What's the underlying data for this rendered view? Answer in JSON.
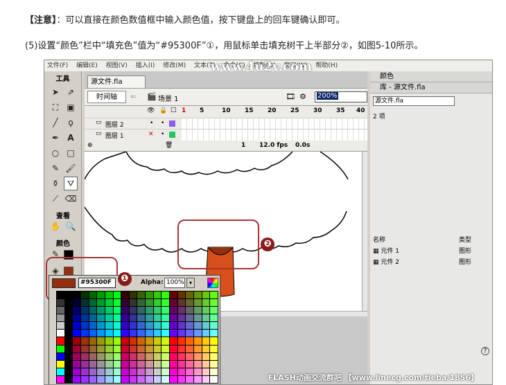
{
  "notes": {
    "line1_bracket": "【注意】",
    "line1_text": "：可以直接在颜色数值框中输入颜色值，按下键盘上的回车键确认即可。",
    "line2_text": "(5)设置“颜色”栏中“填充色”值为“#95300F”①，用鼠标单击填充树干上半部分②，如图5-10所示。"
  },
  "menubar": {
    "items": [
      "文件(F)",
      "编辑(E)",
      "视图(V)",
      "插入(I)",
      "修改(M)",
      "文本(T)",
      "命令(C)",
      "控制(O)",
      "窗口(W)",
      "帮助(H)"
    ]
  },
  "watermark": "www.4u2v.com",
  "tools": {
    "header": "工具",
    "view_header": "查看",
    "colors_header": "颜色"
  },
  "document": {
    "tab": "源文件.fla",
    "timeline_label": "时间轴",
    "scene_label": "场景 1",
    "zoom": "200%",
    "frame_numbers": [
      "1",
      "5",
      "10",
      "15",
      "20",
      "25",
      "30",
      "35",
      "40"
    ],
    "layers": [
      {
        "name": "图层 2",
        "color": "#8b5cf6"
      },
      {
        "name": "图层 1",
        "color": "#22c55e"
      }
    ],
    "status": {
      "frame": "1",
      "fps": "12.0 fps",
      "time": "0.0s"
    }
  },
  "right_panel": {
    "colors_title": "颜色",
    "library_title": "库 - 源文件.fla",
    "library_select": "源文件.fla",
    "item_count": "2 项",
    "col_name": "名称",
    "col_type": "类型",
    "items": [
      {
        "name": "元件 1",
        "type": "图形"
      },
      {
        "name": "元件 2",
        "type": "图形"
      }
    ]
  },
  "color_popup": {
    "hex": "#95300F",
    "alpha_label": "Alpha:",
    "alpha_value": "100%",
    "swatch_color": "#95300f"
  },
  "badges": {
    "one": "❶",
    "two": "❷"
  },
  "footer": "FLASH动画交流群吧 【www.linecg.com/tieba/1856】"
}
